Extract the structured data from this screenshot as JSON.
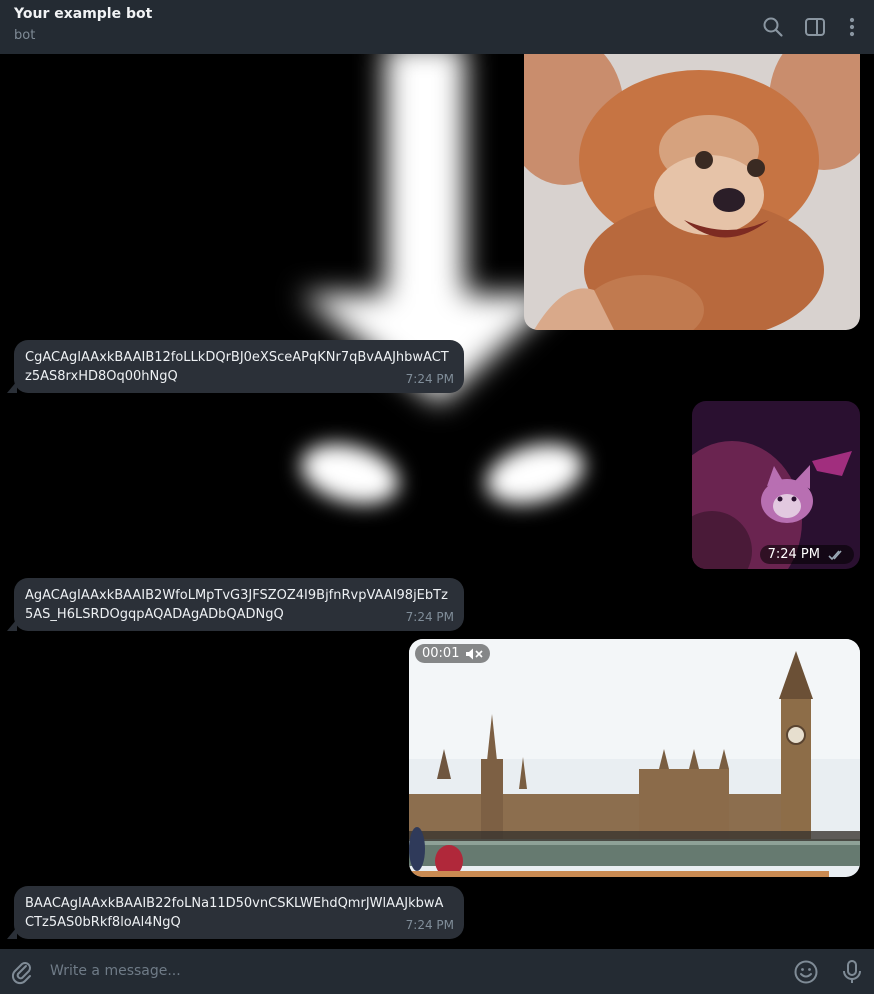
{
  "header": {
    "title": "Your example bot",
    "subtitle": "bot",
    "icons": [
      "search-icon",
      "side-panel-icon",
      "more-vertical-icon"
    ]
  },
  "messages": [
    {
      "type": "sticker",
      "side": "outgoing",
      "content": "cartoon mouse image"
    },
    {
      "type": "text",
      "side": "incoming",
      "text": "CgACAgIAAxkBAAIB12foLLkDQrBJ0eXSceAPqKNr7qBvAAJhbwACTz5AS8rxHD8Oq00hNgQ",
      "time": "7:24 PM"
    },
    {
      "type": "photo",
      "side": "outgoing",
      "time": "7:24 PM",
      "status": "read-double-check-icon"
    },
    {
      "type": "text",
      "side": "incoming",
      "text": "AgACAgIAAxkBAAIB2WfoLMpTvG3JFSZOZ4I9BjfnRvpVAAI98jEbTz5AS_H6LSRDOgqpAQADAgADbQADNgQ",
      "time": "7:24 PM"
    },
    {
      "type": "video",
      "side": "outgoing",
      "duration": "00:01",
      "sound": "muted-speaker-icon"
    },
    {
      "type": "text",
      "side": "incoming",
      "text": "BAACAgIAAxkBAAIB22foLNa11D50vnCSKLWEhdQmrJWlAAJkbwACTz5AS0bRkf8loAl4NgQ",
      "time": "7:24 PM"
    }
  ],
  "input": {
    "placeholder": "Write a message...",
    "icons": [
      "attach-icon",
      "emoji-icon",
      "microphone-icon"
    ]
  },
  "colors": {
    "header_bg": "#242b33",
    "bubble_bg": "#2b3038",
    "chat_bg": "#000000",
    "read_check": "#9aa8b5"
  }
}
